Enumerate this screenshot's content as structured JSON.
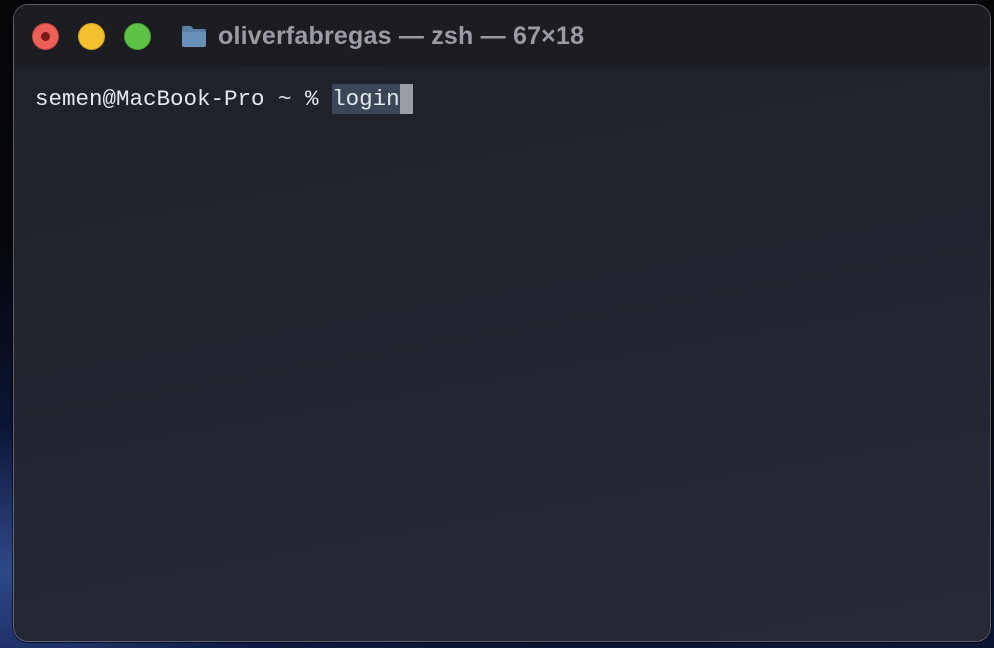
{
  "window": {
    "title": "oliverfabregas — zsh — 67×18",
    "title_icon": "folder-icon"
  },
  "terminal": {
    "lines": [
      {
        "prompt": "semen@MacBook-Pro ~ % ",
        "command": "login"
      }
    ]
  },
  "colors": {
    "close": "#ec5f57",
    "minimize": "#f4c02f",
    "maximize": "#5ec246",
    "folder": "#5b7fa6",
    "selection": "#3b4758",
    "cursor": "#9b9ea6"
  }
}
